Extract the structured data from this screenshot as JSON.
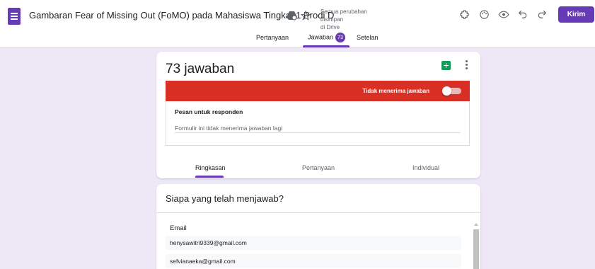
{
  "app": {
    "doc_title": "Gambaran Fear of Missing Out (FoMO) pada Mahasiswa Tingkat 1 Prodi D",
    "save_status_line1": "Semua perubahan disimpan",
    "save_status_line2": "di Drive",
    "send_label": "Kirim",
    "accent_color": "#673ab7"
  },
  "icons": [
    "forms-icon",
    "shared-drive-icon",
    "star-icon",
    "addon-icon",
    "palette-icon",
    "preview-icon",
    "undo-icon",
    "redo-icon",
    "sheets-icon",
    "more-icon"
  ],
  "tabs": [
    {
      "label": "Pertanyaan"
    },
    {
      "label": "Jawaban",
      "badge": "73"
    },
    {
      "label": "Setelan"
    }
  ],
  "responses": {
    "count_label": "73 jawaban",
    "accepting_label": "Tidak menerima jawaban",
    "banner_color": "#d93025",
    "message_label": "Pesan untuk responden",
    "message_value": "Formulir ini tidak menerima jawaban lagi",
    "sub_tabs": [
      {
        "label": "Ringkasan"
      },
      {
        "label": "Pertanyaan"
      },
      {
        "label": "Individual"
      }
    ]
  },
  "who": {
    "title": "Siapa yang telah menjawab?",
    "column_header": "Email",
    "emails": [
      "henysawitri9339@gmail.com",
      "sefvianaeka@gmail.com"
    ]
  }
}
